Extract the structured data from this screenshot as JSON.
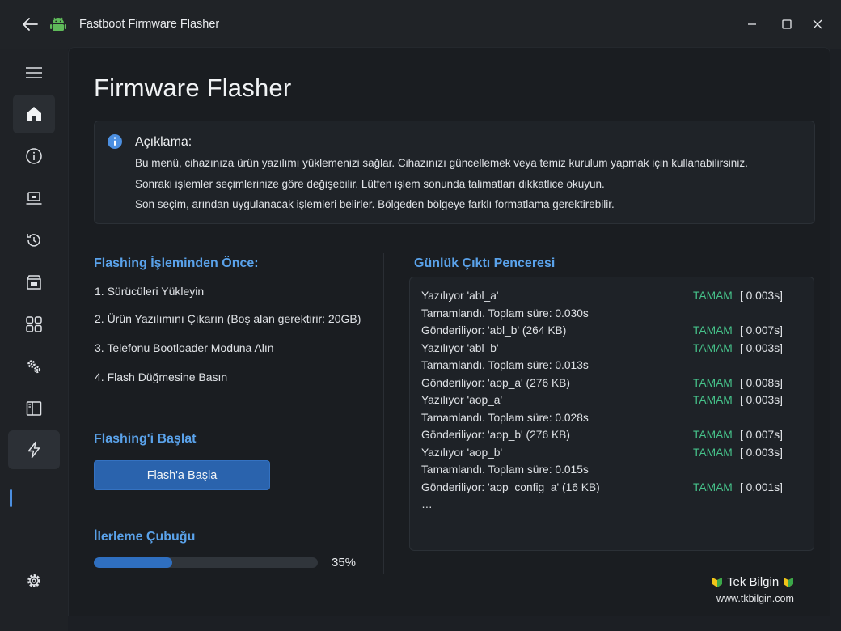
{
  "window": {
    "title": "Fastboot Firmware Flasher"
  },
  "page": {
    "title": "Firmware Flasher"
  },
  "info": {
    "heading": "Açıklama:",
    "lines": [
      "Bu menü, cihazınıza ürün yazılımı yüklemenizi sağlar. Cihazınızı güncellemek veya temiz kurulum yapmak için kullanabilirsiniz.",
      "Sonraki işlemler seçimlerinize göre değişebilir. Lütfen işlem sonunda talimatları dikkatlice okuyun.",
      "Son seçim, arından uygulanacak işlemleri belirler. Bölgeden bölgeye farklı formatlama gerektirebilir."
    ]
  },
  "before": {
    "heading": "Flashing İşleminden Önce:",
    "steps": [
      "1. Sürücüleri Yükleyin",
      "2. Ürün Yazılımını Çıkarın (Boş alan gerektirir: 20GB)",
      "3. Telefonu Bootloader Moduna Alın",
      "4. Flash Düğmesine Basın"
    ]
  },
  "start": {
    "heading": "Flashing'i Başlat",
    "button_label": "Flash'a Başla"
  },
  "progress": {
    "heading": "İlerleme Çubuğu",
    "value_percent": 35,
    "label": "35%"
  },
  "log": {
    "heading": "Günlük Çıktı Penceresi",
    "rows": [
      {
        "msg": "Yazılıyor 'abl_a'",
        "status": "TAMAM",
        "time": "[ 0.003s]"
      },
      {
        "msg": "Tamamlandı. Toplam süre: 0.030s",
        "status": "",
        "time": ""
      },
      {
        "msg": "Gönderiliyor: 'abl_b' (264 KB)",
        "status": "TAMAM",
        "time": "[ 0.007s]"
      },
      {
        "msg": "Yazılıyor 'abl_b'",
        "status": "TAMAM",
        "time": "[ 0.003s]"
      },
      {
        "msg": "Tamamlandı. Toplam süre: 0.013s",
        "status": "",
        "time": ""
      },
      {
        "msg": "Gönderiliyor: 'aop_a' (276 KB)",
        "status": "TAMAM",
        "time": "[ 0.008s]"
      },
      {
        "msg": "Yazılıyor 'aop_a'",
        "status": "TAMAM",
        "time": "[ 0.003s]"
      },
      {
        "msg": "Tamamlandı. Toplam süre: 0.028s",
        "status": "",
        "time": ""
      },
      {
        "msg": "Gönderiliyor: 'aop_b' (276 KB)",
        "status": "TAMAM",
        "time": "[ 0.007s]"
      },
      {
        "msg": "Yazılıyor 'aop_b'",
        "status": "TAMAM",
        "time": "[ 0.003s]"
      },
      {
        "msg": "Tamamlandı. Toplam süre: 0.015s",
        "status": "",
        "time": ""
      },
      {
        "msg": "Gönderiliyor: 'aop_config_a' (16 KB)",
        "status": "TAMAM",
        "time": "[ 0.001s]"
      },
      {
        "msg": "…",
        "status": "",
        "time": ""
      }
    ]
  },
  "brand": {
    "name": "Tek Bilgin",
    "url": "www.tkbilgin.com"
  },
  "colors": {
    "accent": "#5aa2ea",
    "button": "#2a63ad",
    "progress_fill": "#2f6fc0",
    "status_ok": "#46c28a"
  },
  "nav_icons": [
    "menu-icon",
    "home-icon",
    "info-icon",
    "laptop-icon",
    "history-icon",
    "store-icon",
    "apps-icon",
    "gears-icon",
    "book-icon",
    "flash-icon",
    "settings-icon"
  ]
}
